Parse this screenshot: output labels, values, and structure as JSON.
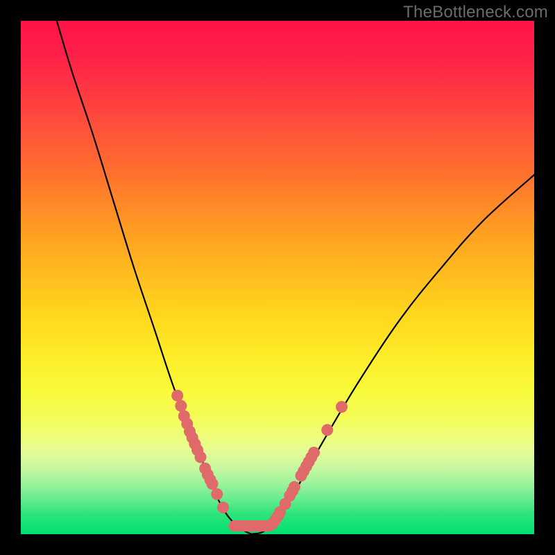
{
  "watermark": "TheBottleneck.com",
  "colors": {
    "frame": "#000000",
    "gradient_top": "#ff1446",
    "gradient_bottom": "#00e070",
    "curve": "#000000",
    "marker": "#e06a6a"
  },
  "chart_data": {
    "type": "line",
    "title": "",
    "xlabel": "",
    "ylabel": "",
    "xlim": [
      0,
      100
    ],
    "ylim": [
      0,
      100
    ],
    "grid": false,
    "legend": false,
    "curve_left": [
      {
        "x": 7,
        "y": 100
      },
      {
        "x": 10,
        "y": 90
      },
      {
        "x": 14,
        "y": 78
      },
      {
        "x": 18,
        "y": 65
      },
      {
        "x": 22,
        "y": 52
      },
      {
        "x": 26,
        "y": 40
      },
      {
        "x": 30,
        "y": 28
      },
      {
        "x": 34,
        "y": 18
      },
      {
        "x": 37,
        "y": 10
      },
      {
        "x": 40,
        "y": 4
      },
      {
        "x": 43,
        "y": 1
      },
      {
        "x": 45,
        "y": 0
      }
    ],
    "curve_right": [
      {
        "x": 45,
        "y": 0
      },
      {
        "x": 48,
        "y": 1
      },
      {
        "x": 52,
        "y": 6
      },
      {
        "x": 56,
        "y": 13
      },
      {
        "x": 60,
        "y": 20
      },
      {
        "x": 66,
        "y": 30
      },
      {
        "x": 74,
        "y": 42
      },
      {
        "x": 82,
        "y": 52
      },
      {
        "x": 90,
        "y": 61
      },
      {
        "x": 100,
        "y": 70
      }
    ],
    "markers_left": [
      {
        "x": 30.5,
        "y": 27
      },
      {
        "x": 31.2,
        "y": 25
      },
      {
        "x": 31.8,
        "y": 23
      },
      {
        "x": 32.4,
        "y": 21.5
      },
      {
        "x": 32.9,
        "y": 20
      },
      {
        "x": 33.4,
        "y": 18.8
      },
      {
        "x": 33.9,
        "y": 17.6
      },
      {
        "x": 34.4,
        "y": 16.4
      },
      {
        "x": 35.0,
        "y": 15
      },
      {
        "x": 35.9,
        "y": 12.8
      },
      {
        "x": 36.4,
        "y": 11.6
      },
      {
        "x": 36.9,
        "y": 10.6
      },
      {
        "x": 37.3,
        "y": 9.8
      },
      {
        "x": 38.2,
        "y": 7.8
      },
      {
        "x": 39.4,
        "y": 5.2
      }
    ],
    "markers_right": [
      {
        "x": 49.0,
        "y": 2.0
      },
      {
        "x": 49.6,
        "y": 2.8
      },
      {
        "x": 50.1,
        "y": 3.6
      },
      {
        "x": 50.5,
        "y": 4.3
      },
      {
        "x": 51.5,
        "y": 5.9
      },
      {
        "x": 52.4,
        "y": 7.5
      },
      {
        "x": 52.9,
        "y": 8.4
      },
      {
        "x": 53.3,
        "y": 9.2
      },
      {
        "x": 54.6,
        "y": 11.4
      },
      {
        "x": 55.1,
        "y": 12.3
      },
      {
        "x": 55.6,
        "y": 13.2
      },
      {
        "x": 56.1,
        "y": 14.1
      },
      {
        "x": 56.6,
        "y": 15.0
      },
      {
        "x": 57.1,
        "y": 15.9
      },
      {
        "x": 59.7,
        "y": 20.3
      },
      {
        "x": 62.5,
        "y": 24.8
      }
    ],
    "bottom_band": {
      "x_start": 40.5,
      "x_end": 49.5,
      "y": 0.5,
      "height": 2.2
    }
  }
}
